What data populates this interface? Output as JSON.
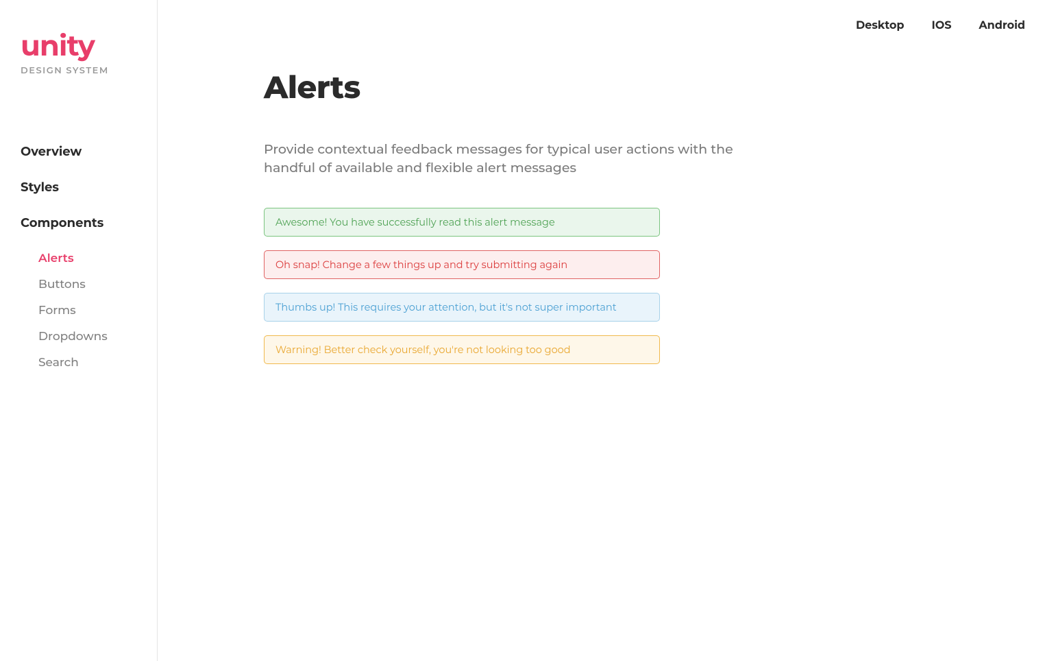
{
  "logo": {
    "title": "unity",
    "subtitle": "DESIGN SYSTEM"
  },
  "sidebar": {
    "items": [
      {
        "label": "Overview"
      },
      {
        "label": "Styles"
      },
      {
        "label": "Components",
        "expanded": true
      }
    ],
    "subitems": [
      {
        "label": "Alerts",
        "active": true
      },
      {
        "label": "Buttons"
      },
      {
        "label": "Forms"
      },
      {
        "label": "Dropdowns"
      },
      {
        "label": "Search"
      }
    ]
  },
  "topbar": {
    "tabs": [
      {
        "label": "Desktop"
      },
      {
        "label": "IOS"
      },
      {
        "label": "Android"
      }
    ]
  },
  "page": {
    "title": "Alerts",
    "description": "Provide contextual feedback messages for typical user actions with the handful of available and flexible alert messages"
  },
  "alerts": [
    {
      "type": "success",
      "text": "Awesome! You have successfully read this alert message"
    },
    {
      "type": "danger",
      "text": "Oh snap! Change a few things up and try submitting again"
    },
    {
      "type": "info",
      "text": "Thumbs up! This requires your attention, but it's not super important"
    },
    {
      "type": "warning",
      "text": "Warning! Better check yourself, you're not looking too good"
    }
  ]
}
